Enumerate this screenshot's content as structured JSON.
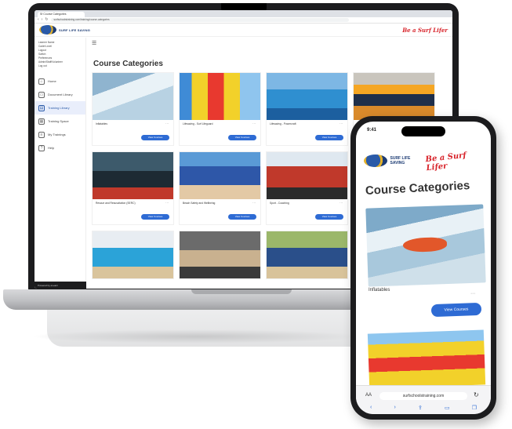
{
  "browser": {
    "tab_title": "Sf Course Categories",
    "url": "surfschoolstraining.com/training/course-categories"
  },
  "app": {
    "brand": "SURF LIFE SAVING",
    "tagline": "Be a Surf Lifer",
    "user_lines": [
      "Learner Name",
      "Cadet Level",
      "Logout",
      "Switch",
      "Preferences",
      "Admin/Staff/Volunteer",
      "Log out"
    ],
    "sidebar": [
      {
        "label": "Home",
        "icon": "home-icon"
      },
      {
        "label": "Document Library",
        "icon": "folder-icon"
      },
      {
        "label": "Training Library",
        "icon": "library-icon",
        "active": true
      },
      {
        "label": "Training Space",
        "icon": "calendar-icon"
      },
      {
        "label": "My Trainings",
        "icon": "list-icon"
      },
      {
        "label": "Help",
        "icon": "help-icon"
      }
    ],
    "footer": "Powered by eLearn"
  },
  "main": {
    "title": "Course Categories",
    "button_label": "View Courses",
    "cards": [
      {
        "name": "Inflatables"
      },
      {
        "name": "Lifesaving - Surf Lifeguard"
      },
      {
        "name": "Lifesaving - Powercraft"
      },
      {
        "name": "IRB Crew & Driver"
      },
      {
        "name": "Rescue and Resuscitation (SERC)"
      },
      {
        "name": "Beach Safety and Wellbeing"
      },
      {
        "name": "Sport - Coaching"
      },
      {
        "name": ""
      },
      {
        "name": ""
      },
      {
        "name": ""
      }
    ]
  },
  "phone": {
    "status_time": "9:41",
    "brand": "SURF LIFE SAVING",
    "tagline": "Be a Surf Lifer",
    "title": "Course Categories",
    "card_name": "Inflatables",
    "button_label": "View Courses",
    "address": "surfschoolstraining.com",
    "aa": "AA"
  },
  "colors": {
    "accent": "#2e6bd4",
    "tagline": "#d8242b",
    "brand": "#1d3c74"
  }
}
